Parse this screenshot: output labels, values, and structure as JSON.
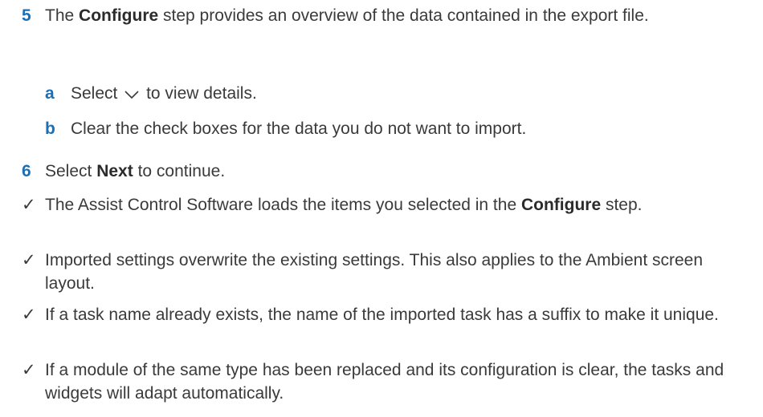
{
  "steps": [
    {
      "number": "5",
      "text_before": "The ",
      "bold": "Configure",
      "text_after": " step provides an overview of the data contained in the export file."
    },
    {
      "number": "6",
      "text_before": "Select ",
      "bold": "Next",
      "text_after": " to continue."
    }
  ],
  "substeps": [
    {
      "letter": "a",
      "text_before": "Select",
      "icon": "chevron-down-icon",
      "text_after": "to view details."
    },
    {
      "letter": "b",
      "text": "Clear the check boxes for the data you do not want to import."
    }
  ],
  "results": {
    "marker": "✓",
    "items": [
      {
        "text_before": "The Assist Control Software loads the items you selected in the ",
        "bold": "Configure",
        "text_after": " step."
      },
      {
        "text": "Imported settings overwrite the existing settings. This also applies to the Ambient screen layout."
      },
      {
        "text": "If a task name already exists, the name of the imported task has a suffix to make it unique."
      },
      {
        "text": "If a module of the same type has been replaced and its configuration is clear, the tasks and widgets will adapt automatically."
      }
    ]
  },
  "colors": {
    "step_number": "#1a6fb5",
    "body_text": "#3a3a3a"
  }
}
